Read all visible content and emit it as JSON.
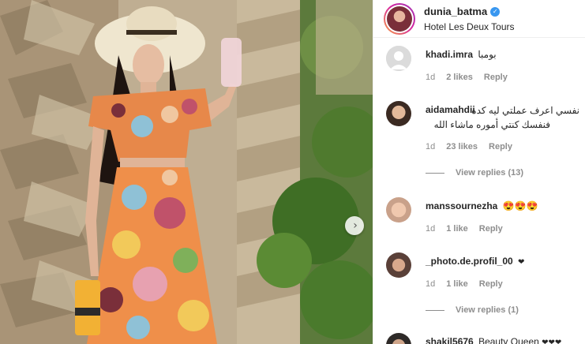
{
  "header": {
    "username": "dunia_batma",
    "location": "Hotel Les Deux Tours",
    "verified_glyph": "✓"
  },
  "photo": {
    "next_glyph": "›"
  },
  "comments": [
    {
      "username": "khadi.imra",
      "text": "بومبا",
      "time": "1d",
      "likes": "2 likes",
      "reply": "Reply"
    },
    {
      "username": "aidamahdii",
      "text_line1": "نفسي اعرف عملتي ليه كده",
      "text_line2": "فنفسك كنتي أموره ماشاء الله",
      "time": "1d",
      "likes": "23 likes",
      "reply": "Reply",
      "view_replies": "View replies (13)"
    },
    {
      "username": "manssournezha",
      "text": "😍😍😍",
      "time": "1d",
      "likes": "1 like",
      "reply": "Reply"
    },
    {
      "username": "_photo.de.profil_00",
      "text": "❤",
      "time": "1d",
      "likes": "1 like",
      "reply": "Reply",
      "view_replies": "View replies (1)"
    },
    {
      "username": "shakil5676",
      "text": "Beauty Queen",
      "hearts": "❤❤❤"
    }
  ],
  "colors": {
    "text": "#262626",
    "muted": "#8e8e8e",
    "verified": "#3897f0",
    "divider": "#efefef"
  }
}
